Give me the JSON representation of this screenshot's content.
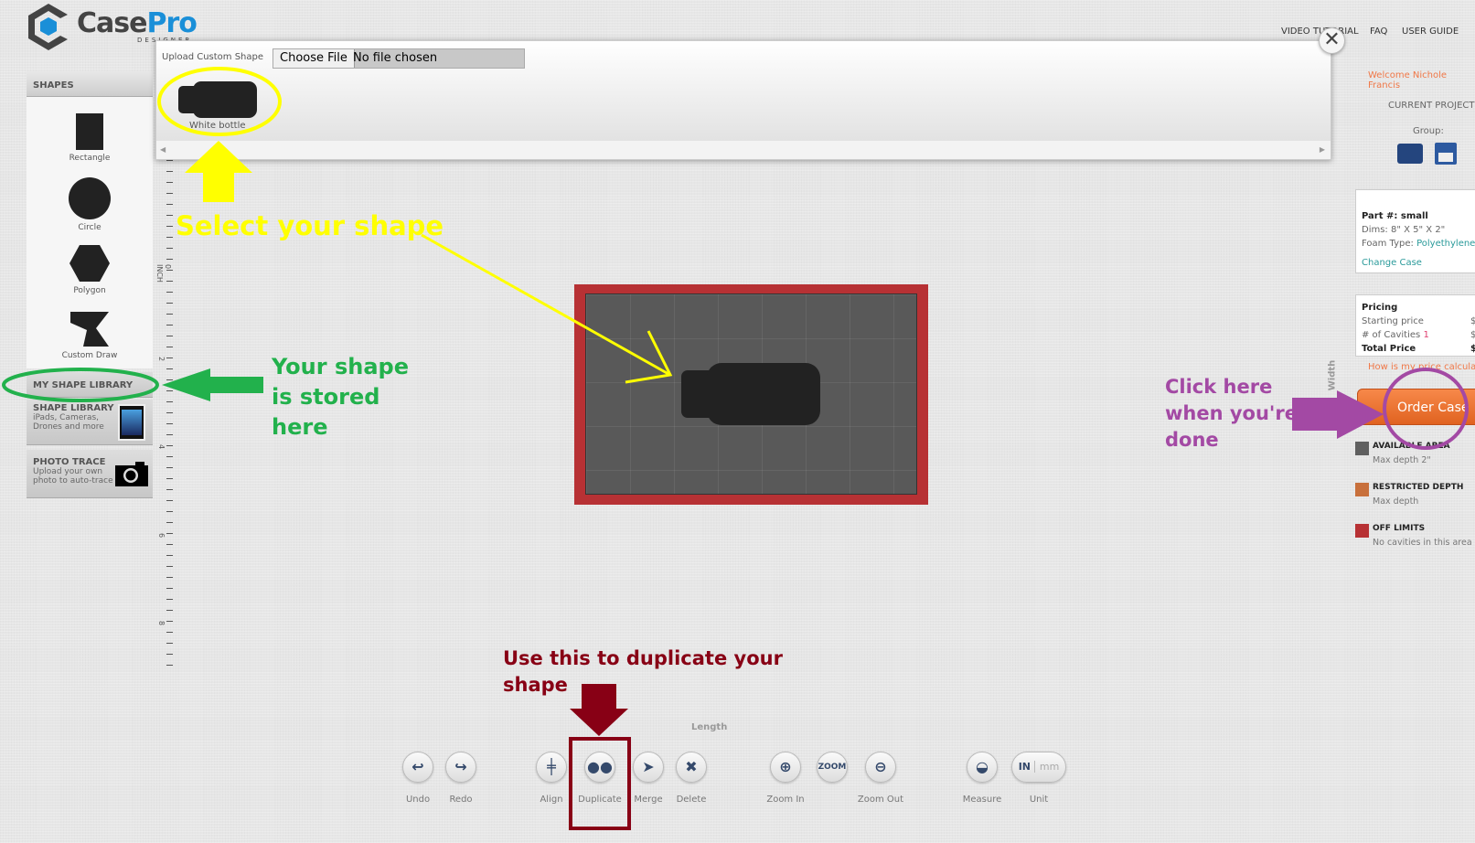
{
  "header": {
    "logo_text": "Case",
    "logo_text_accent": "Pro",
    "logo_sub": "DESIGNER",
    "nav": [
      "VIDEO TUTORIAL",
      "FAQ",
      "USER GUIDE"
    ]
  },
  "popup": {
    "label": "Upload Custom Shape",
    "choose_file": "Choose File",
    "file_status": "No file chosen",
    "shapes": [
      {
        "name": "White bottle"
      }
    ]
  },
  "sidebar": {
    "header": "SHAPES",
    "shapes": [
      "Rectangle",
      "Circle",
      "Polygon",
      "Custom Draw"
    ],
    "my_library": "MY SHAPE LIBRARY",
    "shape_library": {
      "title": "SHAPE LIBRARY",
      "desc1": "iPads, Cameras,",
      "desc2": "Drones and more"
    },
    "photo_trace": {
      "title": "PHOTO TRACE",
      "desc1": "Upload your own",
      "desc2": "photo to auto-trace"
    }
  },
  "ruler": {
    "labels": [
      "0 INCH",
      "2",
      "4",
      "6",
      "8"
    ]
  },
  "canvas": {
    "length_label": "Length",
    "width_label": "Width"
  },
  "right": {
    "welcome": "Welcome Nichole Francis",
    "current_project": "CURRENT PROJECT",
    "group": "Group:",
    "part_label": "Part #:",
    "part_value": "small",
    "dims": "Dims: 8\" X 5\" X 2\"",
    "foam_label": "Foam Type:",
    "foam_value": "Polyethylene",
    "change_case": "Change Case",
    "pricing": {
      "title": "Pricing",
      "starting": "Starting price",
      "starting_val": "$",
      "cavities": "# of Cavities",
      "cavities_count": "1",
      "cavities_val": "$",
      "total": "Total Price",
      "total_val": "$"
    },
    "how_link": "How is my price calculated?",
    "order": "Order Case",
    "legend": [
      {
        "title": "AVAILABLE AREA",
        "desc": "Max depth 2\"",
        "color": "#5f5f5f"
      },
      {
        "title": "RESTRICTED DEPTH",
        "desc": "Max depth",
        "color": "#c8703c"
      },
      {
        "title": "OFF LIMITS",
        "desc": "No cavities in this area",
        "color": "#b73134"
      }
    ]
  },
  "toolbar": {
    "undo": "Undo",
    "redo": "Redo",
    "align": "Align",
    "duplicate": "Duplicate",
    "merge": "Merge",
    "delete": "Delete",
    "zoom_in": "Zoom In",
    "zoom": "ZOOM",
    "zoom_out": "Zoom Out",
    "measure": "Measure",
    "unit": "Unit",
    "unit_in": "IN",
    "unit_mm": "mm"
  },
  "annotations": {
    "select": "Select your shape",
    "stored": [
      "Your shape",
      "is stored",
      "here"
    ],
    "click": [
      "Click here",
      "when you're",
      "done"
    ],
    "duplicate": [
      "Use this to duplicate your",
      "shape"
    ],
    "colors": {
      "yellow": "#ffff00",
      "green": "#22b14c",
      "purple": "#a349a4",
      "darkred": "#880015"
    }
  }
}
